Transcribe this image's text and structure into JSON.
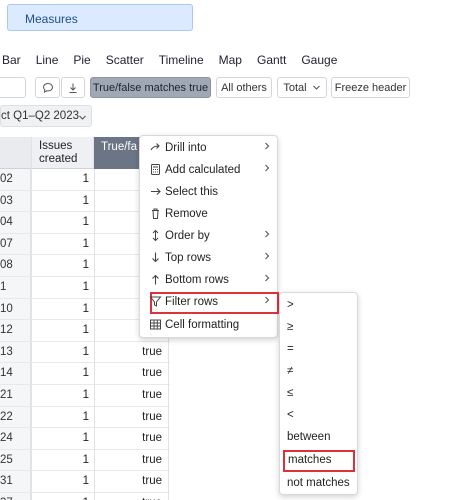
{
  "measures_label": "Measures",
  "chart_types": [
    "Bar",
    "Line",
    "Pie",
    "Scatter",
    "Timeline",
    "Map",
    "Gantt",
    "Gauge"
  ],
  "toolbar": {
    "active_filter": "True/false matches true",
    "all_others": "All others",
    "total": "Total",
    "freeze_header": "Freeze header"
  },
  "period_label": "ct Q1–Q2 2023",
  "table": {
    "col_issues": "Issues created",
    "col_tf": "True/fa",
    "rows": [
      {
        "key": "02",
        "issues": "1",
        "tf": ""
      },
      {
        "key": "03",
        "issues": "1",
        "tf": ""
      },
      {
        "key": "04",
        "issues": "1",
        "tf": ""
      },
      {
        "key": "07",
        "issues": "1",
        "tf": ""
      },
      {
        "key": "08",
        "issues": "1",
        "tf": ""
      },
      {
        "key": "1",
        "issues": "1",
        "tf": ""
      },
      {
        "key": "10",
        "issues": "1",
        "tf": ""
      },
      {
        "key": "12",
        "issues": "1",
        "tf": ""
      },
      {
        "key": "13",
        "issues": "1",
        "tf": "true"
      },
      {
        "key": "14",
        "issues": "1",
        "tf": "true"
      },
      {
        "key": "21",
        "issues": "1",
        "tf": "true"
      },
      {
        "key": "22",
        "issues": "1",
        "tf": "true"
      },
      {
        "key": "24",
        "issues": "1",
        "tf": "true"
      },
      {
        "key": "25",
        "issues": "1",
        "tf": "true"
      },
      {
        "key": "31",
        "issues": "1",
        "tf": "true"
      },
      {
        "key": "37",
        "issues": "1",
        "tf": "true"
      }
    ]
  },
  "context_menu": [
    {
      "label": "Drill into",
      "icon": "drill-icon",
      "submenu": true
    },
    {
      "label": "Add calculated",
      "icon": "calculator-icon",
      "submenu": true
    },
    {
      "label": "Select this",
      "icon": "arrow-right-icon",
      "submenu": false
    },
    {
      "label": "Remove",
      "icon": "trash-icon",
      "submenu": false
    },
    {
      "label": "Order by",
      "icon": "sort-icon",
      "submenu": true
    },
    {
      "label": "Top rows",
      "icon": "arrow-down-icon",
      "submenu": true
    },
    {
      "label": "Bottom rows",
      "icon": "arrow-up-icon",
      "submenu": true
    },
    {
      "label": "Filter rows",
      "icon": "filter-icon",
      "submenu": true
    },
    {
      "label": "Cell formatting",
      "icon": "grid-icon",
      "submenu": false
    }
  ],
  "filter_submenu": [
    ">",
    "≥",
    "=",
    "≠",
    "≤",
    "<",
    "between",
    "matches",
    "not matches"
  ],
  "colors": {
    "highlight": "#e0303a",
    "measures_bg": "#dbeafe",
    "active_btn": "#a0a8b5",
    "column_header": "#6b7585"
  }
}
